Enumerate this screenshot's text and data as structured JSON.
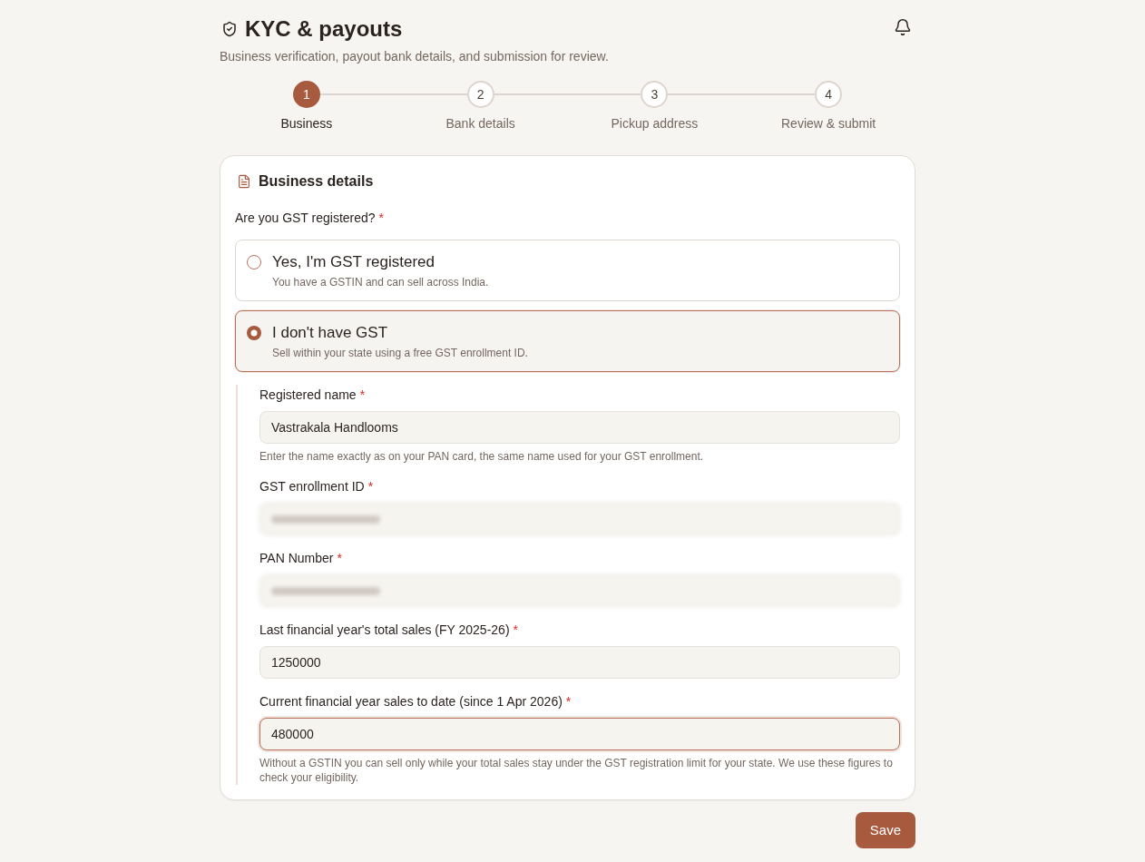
{
  "header": {
    "title": "KYC & payouts",
    "subtitle": "Business verification, payout bank details, and submission for review."
  },
  "steps": [
    {
      "number": "1",
      "label": "Business",
      "selected": true
    },
    {
      "number": "2",
      "label": "Bank details",
      "selected": false
    },
    {
      "number": "3",
      "label": "Pickup address",
      "selected": false
    },
    {
      "number": "4",
      "label": "Review & submit",
      "selected": false
    }
  ],
  "section": {
    "title": "Business details"
  },
  "question": {
    "label": "Are you GST registered?",
    "required_mark": "*"
  },
  "options": [
    {
      "title": "Yes, I'm GST registered",
      "description": "You have a GSTIN and can sell across India.",
      "selected": false
    },
    {
      "title": "I don't have GST",
      "description": "Sell within your state using a free GST enrollment ID.",
      "selected": true
    }
  ],
  "fields": [
    {
      "label": "Registered name",
      "required_mark": "*",
      "value": "Vastrakala Handlooms",
      "help": "Enter the name exactly as on your PAN card, the same name used for your GST enrollment.",
      "focused": false,
      "blurred": false
    },
    {
      "label": "GST enrollment ID",
      "required_mark": "*",
      "focused": false,
      "blurred": true
    },
    {
      "label": "PAN Number",
      "required_mark": "*",
      "focused": false,
      "blurred": true
    },
    {
      "label": "Last financial year's total sales (FY 2025-26)",
      "required_mark": "*",
      "value": "1250000",
      "focused": false,
      "blurred": false
    },
    {
      "label": "Current financial year sales to date (since 1 Apr 2026)",
      "required_mark": "*",
      "value": "480000",
      "help": "Without a GSTIN you can sell only while your total sales stay under the GST registration limit for your state. We use these figures to check your eligibility.",
      "focused": true,
      "blurred": false
    }
  ],
  "save_button": "Save"
}
